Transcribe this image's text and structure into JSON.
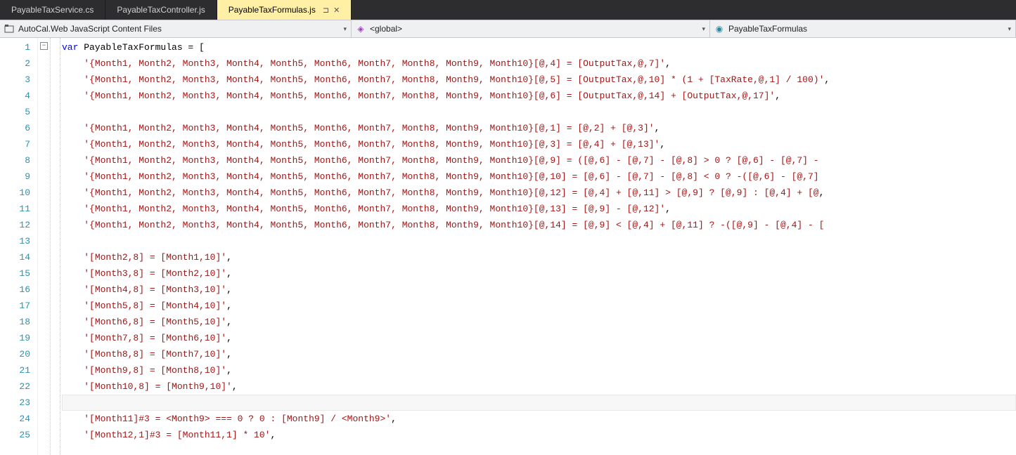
{
  "tabs": [
    {
      "label": "PayableTaxService.cs",
      "active": false
    },
    {
      "label": "PayableTaxController.js",
      "active": false
    },
    {
      "label": "PayableTaxFormulas.js",
      "active": true
    }
  ],
  "nav": {
    "scope": "AutoCal.Web JavaScript Content Files",
    "member1": "<global>",
    "member2": "PayableTaxFormulas"
  },
  "pin_glyph": "⊐",
  "close_glyph": "✕",
  "dropdown_glyph": "▾",
  "fold_glyph": "−",
  "code": {
    "decl_kw": "var",
    "decl_name": " PayableTaxFormulas = [",
    "lines": [
      "'{Month1, Month2, Month3, Month4, Month5, Month6, Month7, Month8, Month9, Month10}[@,4] = [OutputTax,@,7]',",
      "'{Month1, Month2, Month3, Month4, Month5, Month6, Month7, Month8, Month9, Month10}[@,5] = [OutputTax,@,10] * (1 + [TaxRate,@,1] / 100)',",
      "'{Month1, Month2, Month3, Month4, Month5, Month6, Month7, Month8, Month9, Month10}[@,6] = [OutputTax,@,14] + [OutputTax,@,17]',",
      "",
      "'{Month1, Month2, Month3, Month4, Month5, Month6, Month7, Month8, Month9, Month10}[@,1] = [@,2] + [@,3]',",
      "'{Month1, Month2, Month3, Month4, Month5, Month6, Month7, Month8, Month9, Month10}[@,3] = [@,4] + [@,13]',",
      "'{Month1, Month2, Month3, Month4, Month5, Month6, Month7, Month8, Month9, Month10}[@,9] = ([@,6] - [@,7] - [@,8] > 0 ? [@,6] - [@,7] - ",
      "'{Month1, Month2, Month3, Month4, Month5, Month6, Month7, Month8, Month9, Month10}[@,10] = [@,6] - [@,7] - [@,8] < 0 ? -([@,6] - [@,7]",
      "'{Month1, Month2, Month3, Month4, Month5, Month6, Month7, Month8, Month9, Month10}[@,12] = [@,4] + [@,11] > [@,9] ? [@,9] : [@,4] + [@,",
      "'{Month1, Month2, Month3, Month4, Month5, Month6, Month7, Month8, Month9, Month10}[@,13] = [@,9] - [@,12]',",
      "'{Month1, Month2, Month3, Month4, Month5, Month6, Month7, Month8, Month9, Month10}[@,14] = [@,9] < [@,4] + [@,11] ? -([@,9] - [@,4] - [",
      "",
      "'[Month2,8] = [Month1,10]',",
      "'[Month3,8] = [Month2,10]',",
      "'[Month4,8] = [Month3,10]',",
      "'[Month5,8] = [Month4,10]',",
      "'[Month6,8] = [Month5,10]',",
      "'[Month7,8] = [Month6,10]',",
      "'[Month8,8] = [Month7,10]',",
      "'[Month9,8] = [Month8,10]',",
      "'[Month10,8] = [Month9,10]',",
      "",
      "'[Month11]#3 = <Month9> === 0 ? 0 : [Month9] / <Month9>',",
      "'[Month12,1]#3 = [Month11,1] * 10',"
    ]
  },
  "line_start": 1,
  "line_count": 25,
  "current_line": 23
}
